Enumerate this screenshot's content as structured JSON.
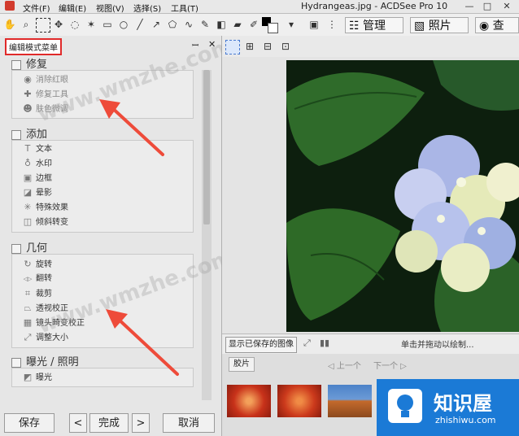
{
  "window": {
    "title": "Hydrangeas.jpg - ACDSee Pro 10",
    "menus": [
      "文件(F)",
      "编辑(E)",
      "视图(V)",
      "选择(S)",
      "工具(T)"
    ],
    "controls": {
      "minimize": "—",
      "maximize": "□",
      "close": "✕"
    }
  },
  "modes": {
    "manage": "管理",
    "photos": "照片",
    "view": "查看"
  },
  "panel": {
    "title": "编辑模式菜单",
    "pin": "ꟷ",
    "close": "✕",
    "sections": [
      {
        "label": "修复",
        "items": [
          {
            "icon": "eye-icon",
            "glyph": "◉",
            "label": "消除红眼",
            "disabled": true
          },
          {
            "icon": "bandage-icon",
            "glyph": "✚",
            "label": "修复工具",
            "disabled": true
          },
          {
            "icon": "face-icon",
            "glyph": "☻",
            "label": "肤色微调",
            "disabled": true
          }
        ]
      },
      {
        "label": "添加",
        "items": [
          {
            "icon": "text-icon",
            "glyph": "T",
            "label": "文本",
            "disabled": false
          },
          {
            "icon": "stamp-icon",
            "glyph": "♁",
            "label": "水印",
            "disabled": false
          },
          {
            "icon": "frame-icon",
            "glyph": "▣",
            "label": "边框",
            "disabled": false
          },
          {
            "icon": "shadow-icon",
            "glyph": "◪",
            "label": "晕影",
            "disabled": false
          },
          {
            "icon": "effects-icon",
            "glyph": "✳",
            "label": "特殊效果",
            "disabled": false
          },
          {
            "icon": "tilt-shift-icon",
            "glyph": "◫",
            "label": "倾斜转变",
            "disabled": false
          }
        ]
      },
      {
        "label": "几何",
        "items": [
          {
            "icon": "rotate-icon",
            "glyph": "↻",
            "label": "旋转",
            "disabled": false
          },
          {
            "icon": "flip-icon",
            "glyph": "◁▷",
            "label": "翻转",
            "disabled": false
          },
          {
            "icon": "crop-icon",
            "glyph": "⌗",
            "label": "裁剪",
            "disabled": false
          },
          {
            "icon": "perspective-icon",
            "glyph": "⏢",
            "label": "透视校正",
            "disabled": false
          },
          {
            "icon": "lens-icon",
            "glyph": "▦",
            "label": "镜头畸变校正",
            "disabled": false
          },
          {
            "icon": "resize-icon",
            "glyph": "⤢",
            "label": "调整大小",
            "disabled": false
          }
        ]
      },
      {
        "label": "曝光 / 照明",
        "items": [
          {
            "icon": "exposure-icon",
            "glyph": "◩",
            "label": "曝光",
            "disabled": false
          }
        ]
      }
    ],
    "buttons": {
      "save": "保存",
      "prev": "<",
      "done": "完成",
      "next": ">",
      "cancel": "取消"
    }
  },
  "statusbar": {
    "show_saved": "显示已保存的图像",
    "hint": "单击并拖动以绘制..."
  },
  "filmstrip": {
    "tab": "胶片",
    "prev": "上一个",
    "next": "下一个"
  },
  "watermark": "www.wmzhe.com",
  "logo": {
    "name": "知识屋",
    "url": "zhishiwu.com"
  },
  "colors": {
    "arrow": "#ee4b3a",
    "highlight": "#e02a2a",
    "logo_bg": "#1b7ad6"
  }
}
